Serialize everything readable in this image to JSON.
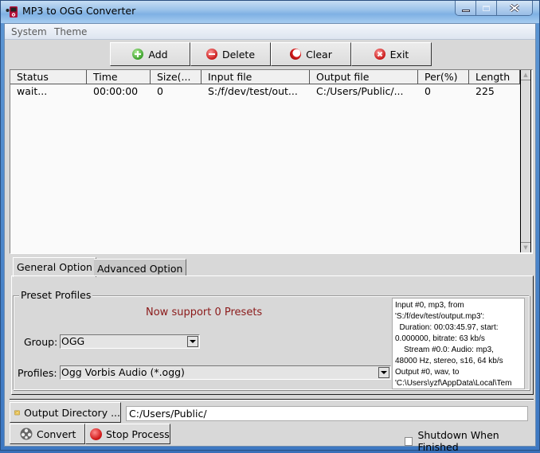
{
  "window": {
    "title": "MP3 to OGG Converter",
    "controls": {
      "minimize": "minimize-icon",
      "maximize": "maximize-icon",
      "close": "close-icon"
    }
  },
  "menu": [
    "System",
    "Theme"
  ],
  "toolbar": [
    {
      "label": "Add",
      "icon": "add-icon"
    },
    {
      "label": "Delete",
      "icon": "delete-icon"
    },
    {
      "label": "Clear",
      "icon": "clear-icon"
    },
    {
      "label": "Exit",
      "icon": "exit-icon"
    }
  ],
  "file_list": {
    "columns": [
      "Status",
      "Time",
      "Size(...",
      "Input file",
      "Output file",
      "Per(%)",
      "Length"
    ],
    "rows": [
      [
        "wait...",
        "00:00:00",
        "0",
        "S:/f/dev/test/out...",
        "C:/Users/Public/...",
        "0",
        "225"
      ]
    ]
  },
  "tabs": [
    {
      "label": "General Option",
      "active": true
    },
    {
      "label": "Advanced Option",
      "active": false
    }
  ],
  "preset_profiles": {
    "legend": "Preset Profiles",
    "note": "Now support 0 Presets",
    "note_color": "#8b1a1a",
    "group_label": "Group:",
    "group_value": "OGG",
    "profiles_label": "Profiles:",
    "profiles_value": "Ogg Vorbis Audio (*.ogg)"
  },
  "info_log": "Input #0, mp3, from\n'S:/f/dev/test/output.mp3':\n  Duration: 00:03:45.97, start:\n0.000000, bitrate: 63 kb/s\n    Stream #0.0: Audio: mp3,\n48000 Hz, stereo, s16, 64 kb/s\nOutput #0, wav, to\n'C:\\Users\\yzf\\AppData\\Local\\Tem",
  "output_directory": {
    "button_label": "Output Directory ...",
    "value": "C:/Users/Public/"
  },
  "actions": {
    "convert_label": "Convert",
    "stop_label": "Stop Process"
  },
  "shutdown_checkbox": {
    "label": "Shutdown When Finished",
    "checked": false
  }
}
